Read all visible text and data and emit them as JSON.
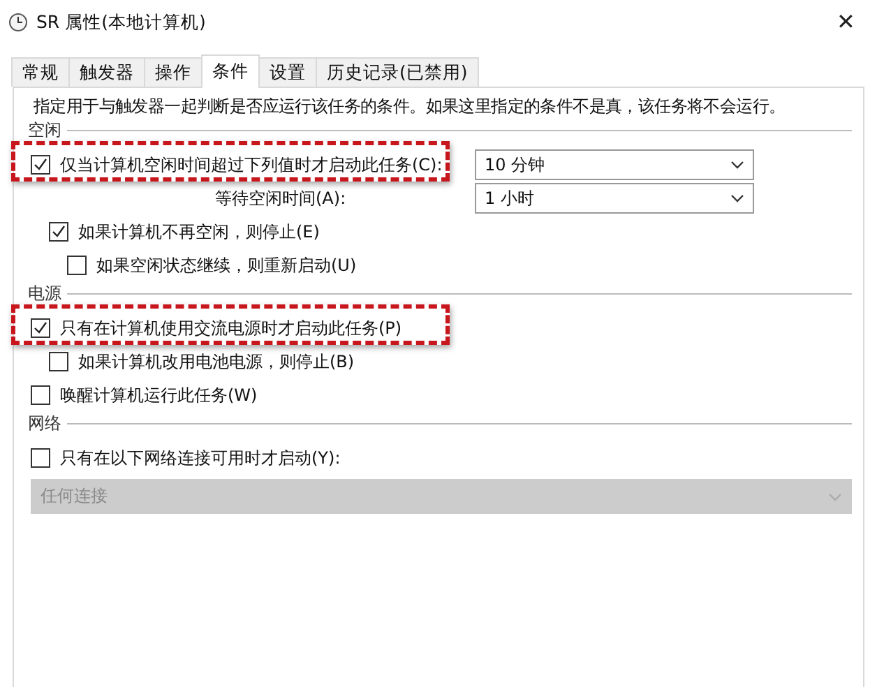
{
  "window": {
    "title": "SR 属性(本地计算机)",
    "close": "✕"
  },
  "tabs": [
    {
      "label": "常规",
      "selected": false
    },
    {
      "label": "触发器",
      "selected": false
    },
    {
      "label": "操作",
      "selected": false
    },
    {
      "label": "条件",
      "selected": true
    },
    {
      "label": "设置",
      "selected": false
    },
    {
      "label": "历史记录(已禁用)",
      "selected": false
    }
  ],
  "description": "指定用于与触发器一起判断是否应运行该任务的条件。如果这里指定的条件不是真，该任务将不会运行。",
  "sections": [
    {
      "title": "空闲",
      "items": [
        {
          "kind": "checkbox",
          "label": "仅当计算机空闲时间超过下列值时才启动此任务(C):",
          "checked": true,
          "highlighted": true,
          "dropdown": {
            "value": "10 分钟",
            "disabled": false
          },
          "children": [
            {
              "kind": "field",
              "label": "等待空闲时间(A):",
              "dropdown": {
                "value": "1 小时",
                "disabled": false
              }
            },
            {
              "kind": "checkbox",
              "label": "如果计算机不再空闲，则停止(E)",
              "checked": true,
              "highlighted": false,
              "children": [
                {
                  "kind": "checkbox",
                  "label": "如果空闲状态继续，则重新启动(U)",
                  "checked": false,
                  "highlighted": false
                }
              ]
            }
          ]
        }
      ]
    },
    {
      "title": "电源",
      "items": [
        {
          "kind": "checkbox",
          "label": "只有在计算机使用交流电源时才启动此任务(P)",
          "checked": true,
          "highlighted": true,
          "children": [
            {
              "kind": "checkbox",
              "label": "如果计算机改用电池电源，则停止(B)",
              "checked": false,
              "highlighted": false
            }
          ]
        },
        {
          "kind": "checkbox",
          "label": "唤醒计算机运行此任务(W)",
          "checked": false,
          "highlighted": false
        }
      ]
    },
    {
      "title": "网络",
      "items": [
        {
          "kind": "checkbox",
          "label": "只有在以下网络连接可用时才启动(Y):",
          "checked": false,
          "highlighted": false
        },
        {
          "kind": "wide-dropdown",
          "dropdown": {
            "value": "任何连接",
            "disabled": true
          }
        }
      ]
    }
  ]
}
